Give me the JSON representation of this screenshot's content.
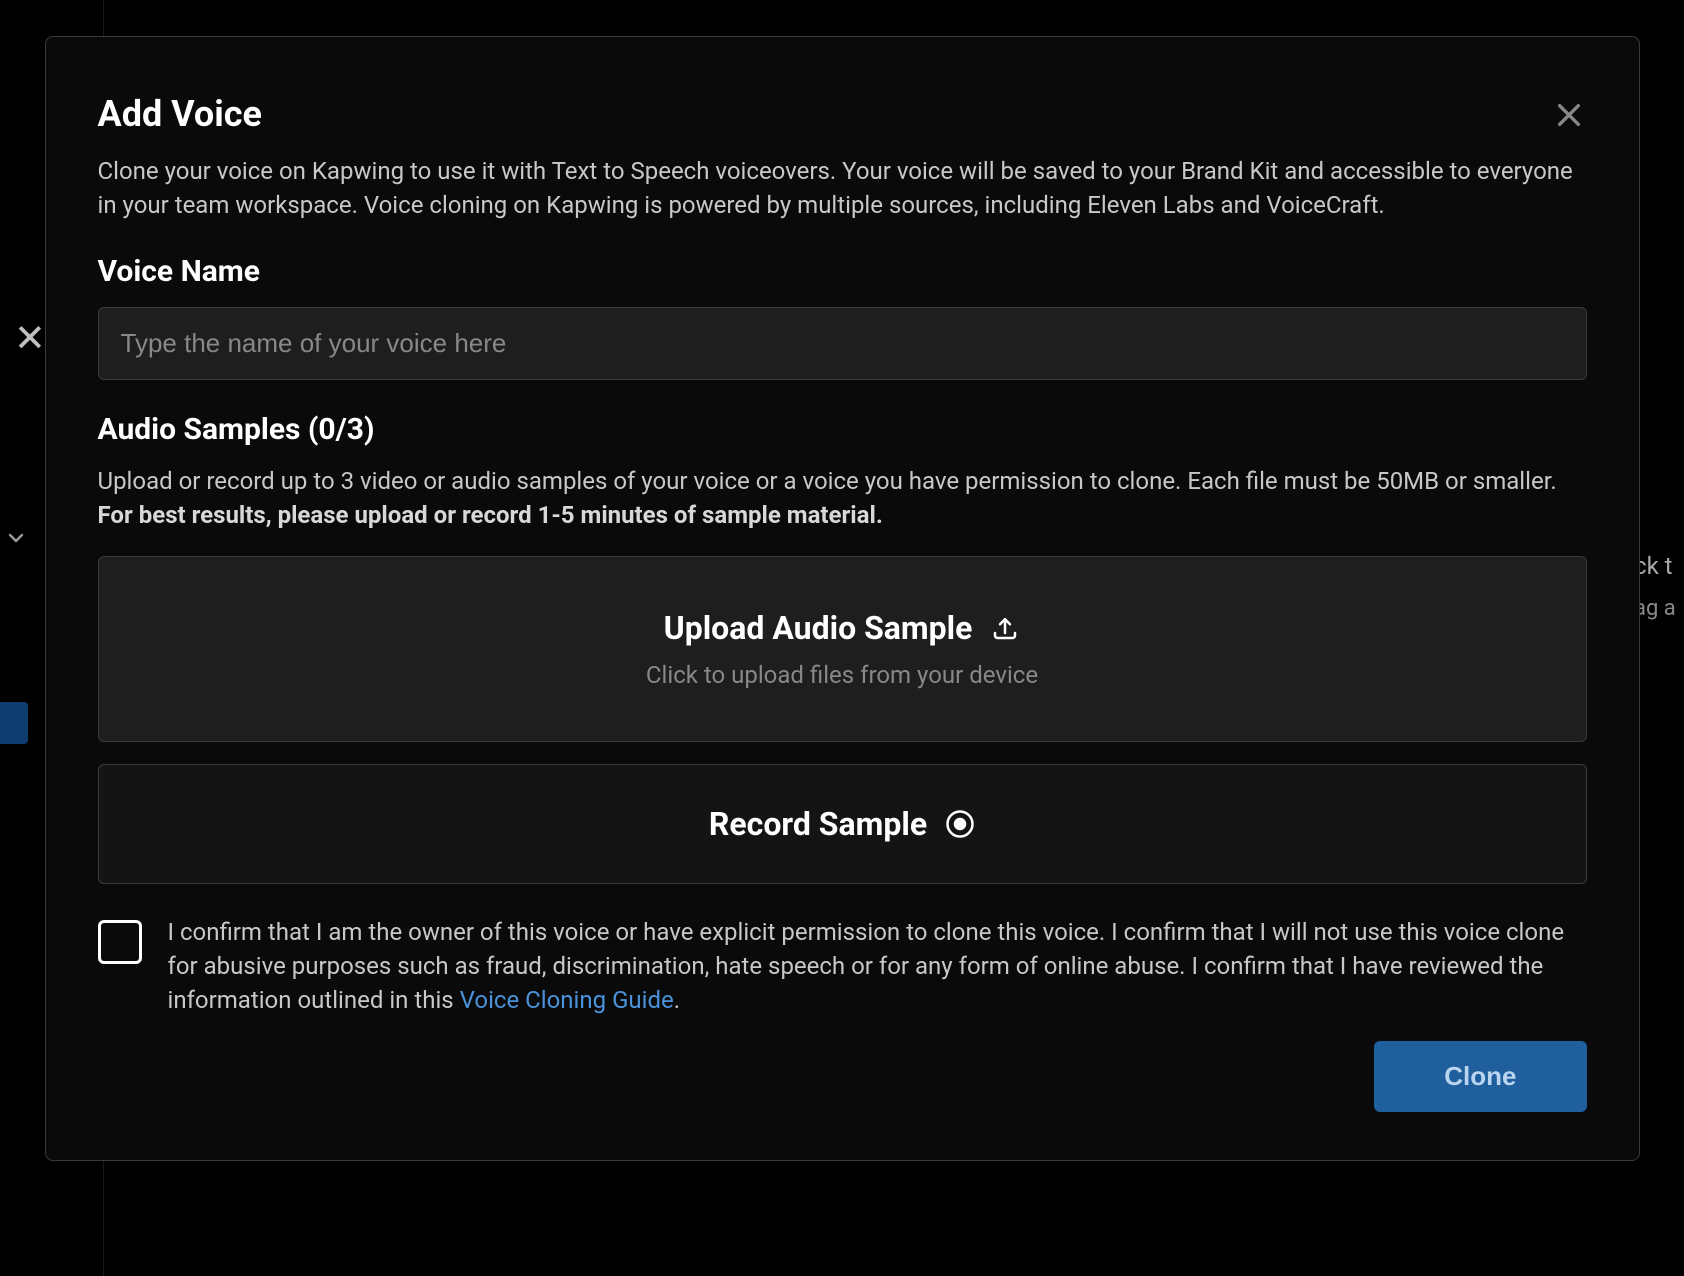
{
  "modal": {
    "title": "Add Voice",
    "description": "Clone your voice on Kapwing to use it with Text to Speech voiceovers. Your voice will be saved to your Brand Kit and accessible to everyone in your team workspace. Voice cloning on Kapwing is powered by multiple sources, including Eleven Labs and VoiceCraft.",
    "voice_name": {
      "label": "Voice Name",
      "placeholder": "Type the name of your voice here",
      "value": ""
    },
    "audio_samples": {
      "heading": "Audio Samples (0/3)",
      "description_start": "Upload or record up to 3 video or audio samples of your voice or a voice you have permission to clone. Each file must be 50MB or smaller. ",
      "description_bold": "For best results, please upload or record 1-5 minutes of sample material."
    },
    "upload": {
      "title": "Upload Audio Sample",
      "subtext": "Click to upload files from your device"
    },
    "record": {
      "title": "Record Sample"
    },
    "confirm": {
      "text_start": "I confirm that I am the owner of this voice or have explicit permission to clone this voice. I confirm that I will not use this voice clone for abusive purposes such as fraud, discrimination, hate speech or for any form of online abuse. I confirm that I have reviewed the information outlined in this ",
      "link_text": "Voice Cloning Guide",
      "text_end": "."
    },
    "clone_button": "Clone"
  },
  "background": {
    "right_text1": "ck t",
    "right_text2": "ag a"
  }
}
